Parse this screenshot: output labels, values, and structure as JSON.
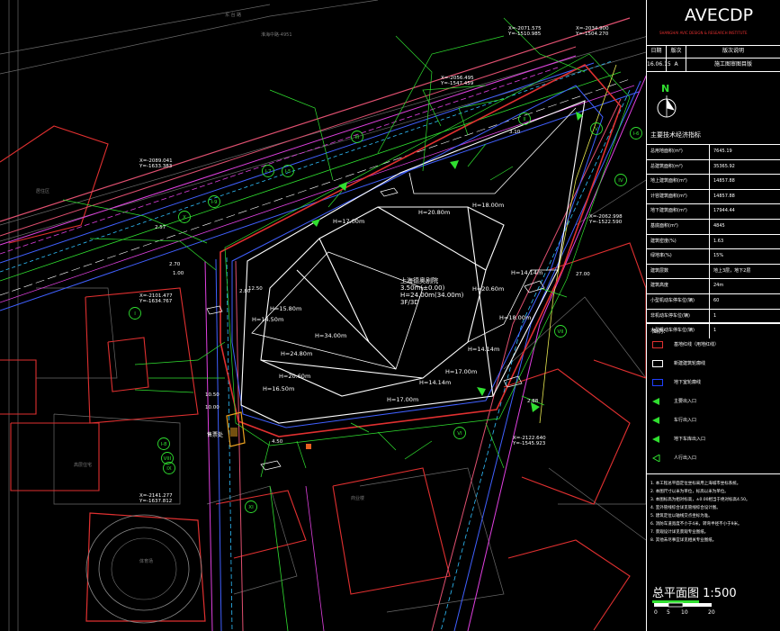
{
  "logo": {
    "text": "AVECDP",
    "subtitle": "SHANGHAI AVIC DESIGN & RESEARCH INSTITUTE"
  },
  "revisions": {
    "headers": [
      "日期",
      "版次",
      "版次说明"
    ],
    "rows": [
      {
        "date": "16.06.15",
        "rev": "A",
        "desc": "施工图审图目版"
      }
    ]
  },
  "north_label": "N",
  "indicators": {
    "title": "主要技术经济指标",
    "rows": [
      {
        "k": "总用地面积(m²)",
        "v": "7645.19"
      },
      {
        "k": "总建筑面积(m²)",
        "v": "35365.92"
      },
      {
        "k": "地上建筑面积(m²)",
        "v": "14857.88"
      },
      {
        "k": "计容建筑面积(m²)",
        "v": "14857.88"
      },
      {
        "k": "地下建筑面积(m²)",
        "v": "17944.44"
      },
      {
        "k": "基底面积(m²)",
        "v": "4845"
      },
      {
        "k": "建筑密度(%)",
        "v": "1.63"
      },
      {
        "k": "绿地率(%)",
        "v": "15%"
      },
      {
        "k": "建筑层数",
        "v": "地上3层，地下2层"
      },
      {
        "k": "建筑高度",
        "v": "24m"
      },
      {
        "k": "小型机动车停车位(辆)",
        "v": "60"
      },
      {
        "k": "非机动车停车位(辆)",
        "v": "1"
      },
      {
        "k": "大型机动车停车位(辆)",
        "v": "1"
      }
    ]
  },
  "legend": {
    "head": "图例：",
    "items": [
      {
        "color": "#e03030",
        "label": "基地红线（用地红线）",
        "type": "box"
      },
      {
        "color": "#ffffff",
        "label": "新建建筑轮廓线",
        "type": "box"
      },
      {
        "color": "#2040ff",
        "label": "地下室轮廓线",
        "type": "box"
      },
      {
        "color": "#30e030",
        "label": "主要出入口",
        "type": "arrow"
      },
      {
        "color": "#30e030",
        "label": "车行出入口",
        "type": "arrow"
      },
      {
        "color": "#30e030",
        "label": "地下车库出入口",
        "type": "tri"
      },
      {
        "color": "#30e030",
        "label": "人行出入口",
        "type": "tri-open"
      }
    ]
  },
  "notes": [
    "1. 本工程总平面定位坐标采用上海城市坐标系统。",
    "2. 本图尺寸以米为单位，标高以米为单位。",
    "3. 本图标高为相对标高，±0.00相当于绝对标高4.50。",
    "4. 室外管线综合详见管线综合设计图。",
    "5. 建筑定位以轴线交点坐标为准。",
    "6. 消防车道宽度不小于4米，转弯半径不小于9米。",
    "7. 景观设计详见景观专业图纸。",
    "8. 其他未尽事宜详见相关专业图纸。"
  ],
  "plan_title": {
    "name": "总平面图",
    "scale": "1:500"
  },
  "scale_ticks": [
    "0",
    "5",
    "10",
    "20"
  ],
  "building": {
    "name": "上海德奥剧院",
    "lines": [
      "3.50m(±0.00)",
      "H=24.00m(34.00m)",
      "3F/3D"
    ]
  },
  "heights": [
    "H=17.00m",
    "H=20.80m",
    "H=18.00m",
    "H=14.14m",
    "H=20.60m",
    "H=18.00m",
    "H=14.14m",
    "H=17.00m",
    "H=34.00m",
    "H=24.80m",
    "H=20.60m",
    "H=16.50m",
    "H=15.80m",
    "H=14.50m",
    "H=17.00m",
    "H=14.14m"
  ],
  "coords": [
    {
      "x": "X=-2071.575",
      "y": "Y=-1510.985"
    },
    {
      "x": "X=-2034.900",
      "y": "Y=-1504.270"
    },
    {
      "x": "X=-2056.495",
      "y": "Y=-1547.459"
    },
    {
      "x": "X=-2089.041",
      "y": "Y=-1633.383"
    },
    {
      "x": "X=-2101.477",
      "y": "Y=-1634.767"
    },
    {
      "x": "X=-2062.998",
      "y": "Y=-1522.590"
    },
    {
      "x": "X=-2122.640",
      "y": "Y=-1545.923"
    },
    {
      "x": "X=-2141.277",
      "y": "Y=-1637.812"
    }
  ],
  "roman_markers": [
    "II",
    "III",
    "IV",
    "V",
    "VI",
    "VII",
    "VIII",
    "IX",
    "X",
    "XI",
    "I-9",
    "I-7",
    "I-5",
    "I-6",
    "I-8",
    "I"
  ],
  "dims": [
    "2.57",
    "2.70",
    "1.00",
    "3.10",
    "2.88",
    "27.00",
    "10.50",
    "2.80",
    "12.50",
    "4.50",
    "10.00"
  ],
  "ticket_text": "售票处"
}
